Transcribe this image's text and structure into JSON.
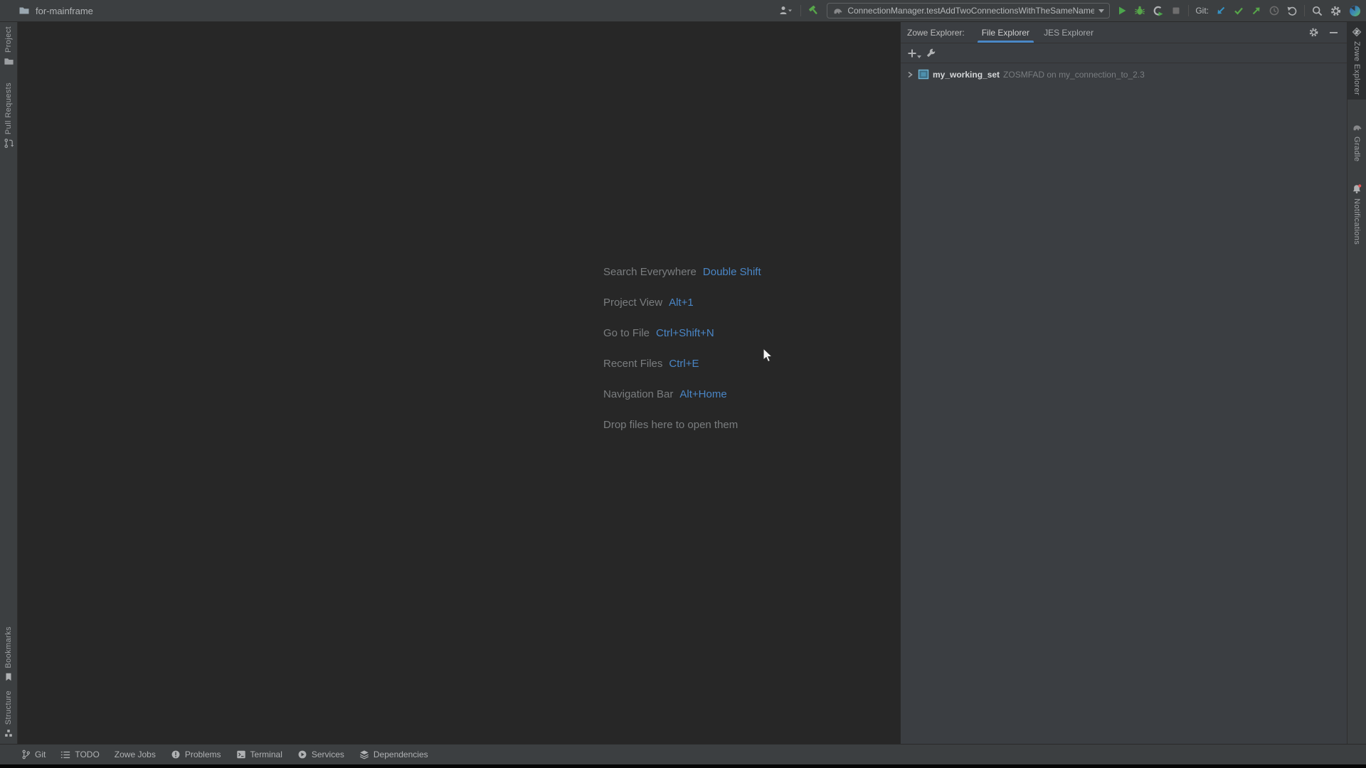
{
  "titlebar": {
    "project_name": "for-mainframe",
    "run_config": "ConnectionManager.testAddTwoConnectionsWithTheSameName",
    "git_label": "Git:"
  },
  "left_stripe": {
    "top": [
      {
        "label": "Project"
      },
      {
        "label": "Pull Requests"
      }
    ],
    "bottom": [
      {
        "label": "Bookmarks"
      },
      {
        "label": "Structure"
      }
    ]
  },
  "right_stripe": {
    "items": [
      {
        "label": "Zowe Explorer",
        "active": true
      },
      {
        "label": "Gradle",
        "active": false
      },
      {
        "label": "Notifications",
        "active": false
      }
    ]
  },
  "editor": {
    "shortcuts": [
      {
        "label": "Search Everywhere",
        "keys": "Double Shift"
      },
      {
        "label": "Project View",
        "keys": "Alt+1"
      },
      {
        "label": "Go to File",
        "keys": "Ctrl+Shift+N"
      },
      {
        "label": "Recent Files",
        "keys": "Ctrl+E"
      },
      {
        "label": "Navigation Bar",
        "keys": "Alt+Home"
      },
      {
        "label": "Drop files here to open them",
        "keys": ""
      }
    ]
  },
  "panel": {
    "title": "Zowe Explorer:",
    "tabs": [
      {
        "label": "File Explorer",
        "active": true
      },
      {
        "label": "JES Explorer",
        "active": false
      }
    ],
    "tree": [
      {
        "name": "my_working_set",
        "detail": "ZOSMFAD on my_connection_to_2.3"
      }
    ]
  },
  "statusbar": {
    "items": [
      {
        "label": "Git",
        "icon": "git-branch-icon"
      },
      {
        "label": "TODO",
        "icon": "todo-icon"
      },
      {
        "label": "Zowe Jobs",
        "icon": ""
      },
      {
        "label": "Problems",
        "icon": "problems-icon"
      },
      {
        "label": "Terminal",
        "icon": "terminal-icon"
      },
      {
        "label": "Services",
        "icon": "services-icon"
      },
      {
        "label": "Dependencies",
        "icon": "dependencies-icon"
      }
    ]
  },
  "icons": {
    "folder-icon": "gray folder glyph",
    "users-icon": "person bust with dropdown caret",
    "build-hammer-icon": "green hammer",
    "gradle-elephant-icon": "gray elephant",
    "run-icon": "green play triangle",
    "debug-icon": "green bug",
    "coverage-icon": "C with green play",
    "stop-icon": "gray square (disabled)",
    "git-update-icon": "blue down-left arrow",
    "git-commit-icon": "green check",
    "git-push-icon": "green up-right arrow",
    "history-icon": "gray clock (disabled)",
    "rollback-icon": "gray undo arc",
    "search-icon": "magnifier",
    "settings-gear-icon": "gear",
    "account-sphere-icon": "blue-green gradient sphere",
    "add-icon": "plus with caret",
    "wrench-icon": "wrench",
    "minimize-icon": "horizontal bar",
    "chevron-right-icon": "tree expander",
    "working-set-icon": "blue bordered square",
    "pull-request-icon": "branch merge glyph",
    "bookmark-icon": "bookmark flag",
    "structure-icon": "squares cluster",
    "zowe-diamond-icon": "diamond with Z",
    "bell-icon": "bell with red badge",
    "mouse-cursor": "white arrow pointer"
  },
  "colors": {
    "accent_blue": "#4a86c6",
    "tab_underline": "#4a88c7",
    "green": "#57a64a",
    "update_blue": "#3592c4",
    "panel_bg": "#3b3e42",
    "editor_bg": "#272727",
    "chrome_bg": "#3c3f41",
    "badge_red": "#e05555"
  }
}
